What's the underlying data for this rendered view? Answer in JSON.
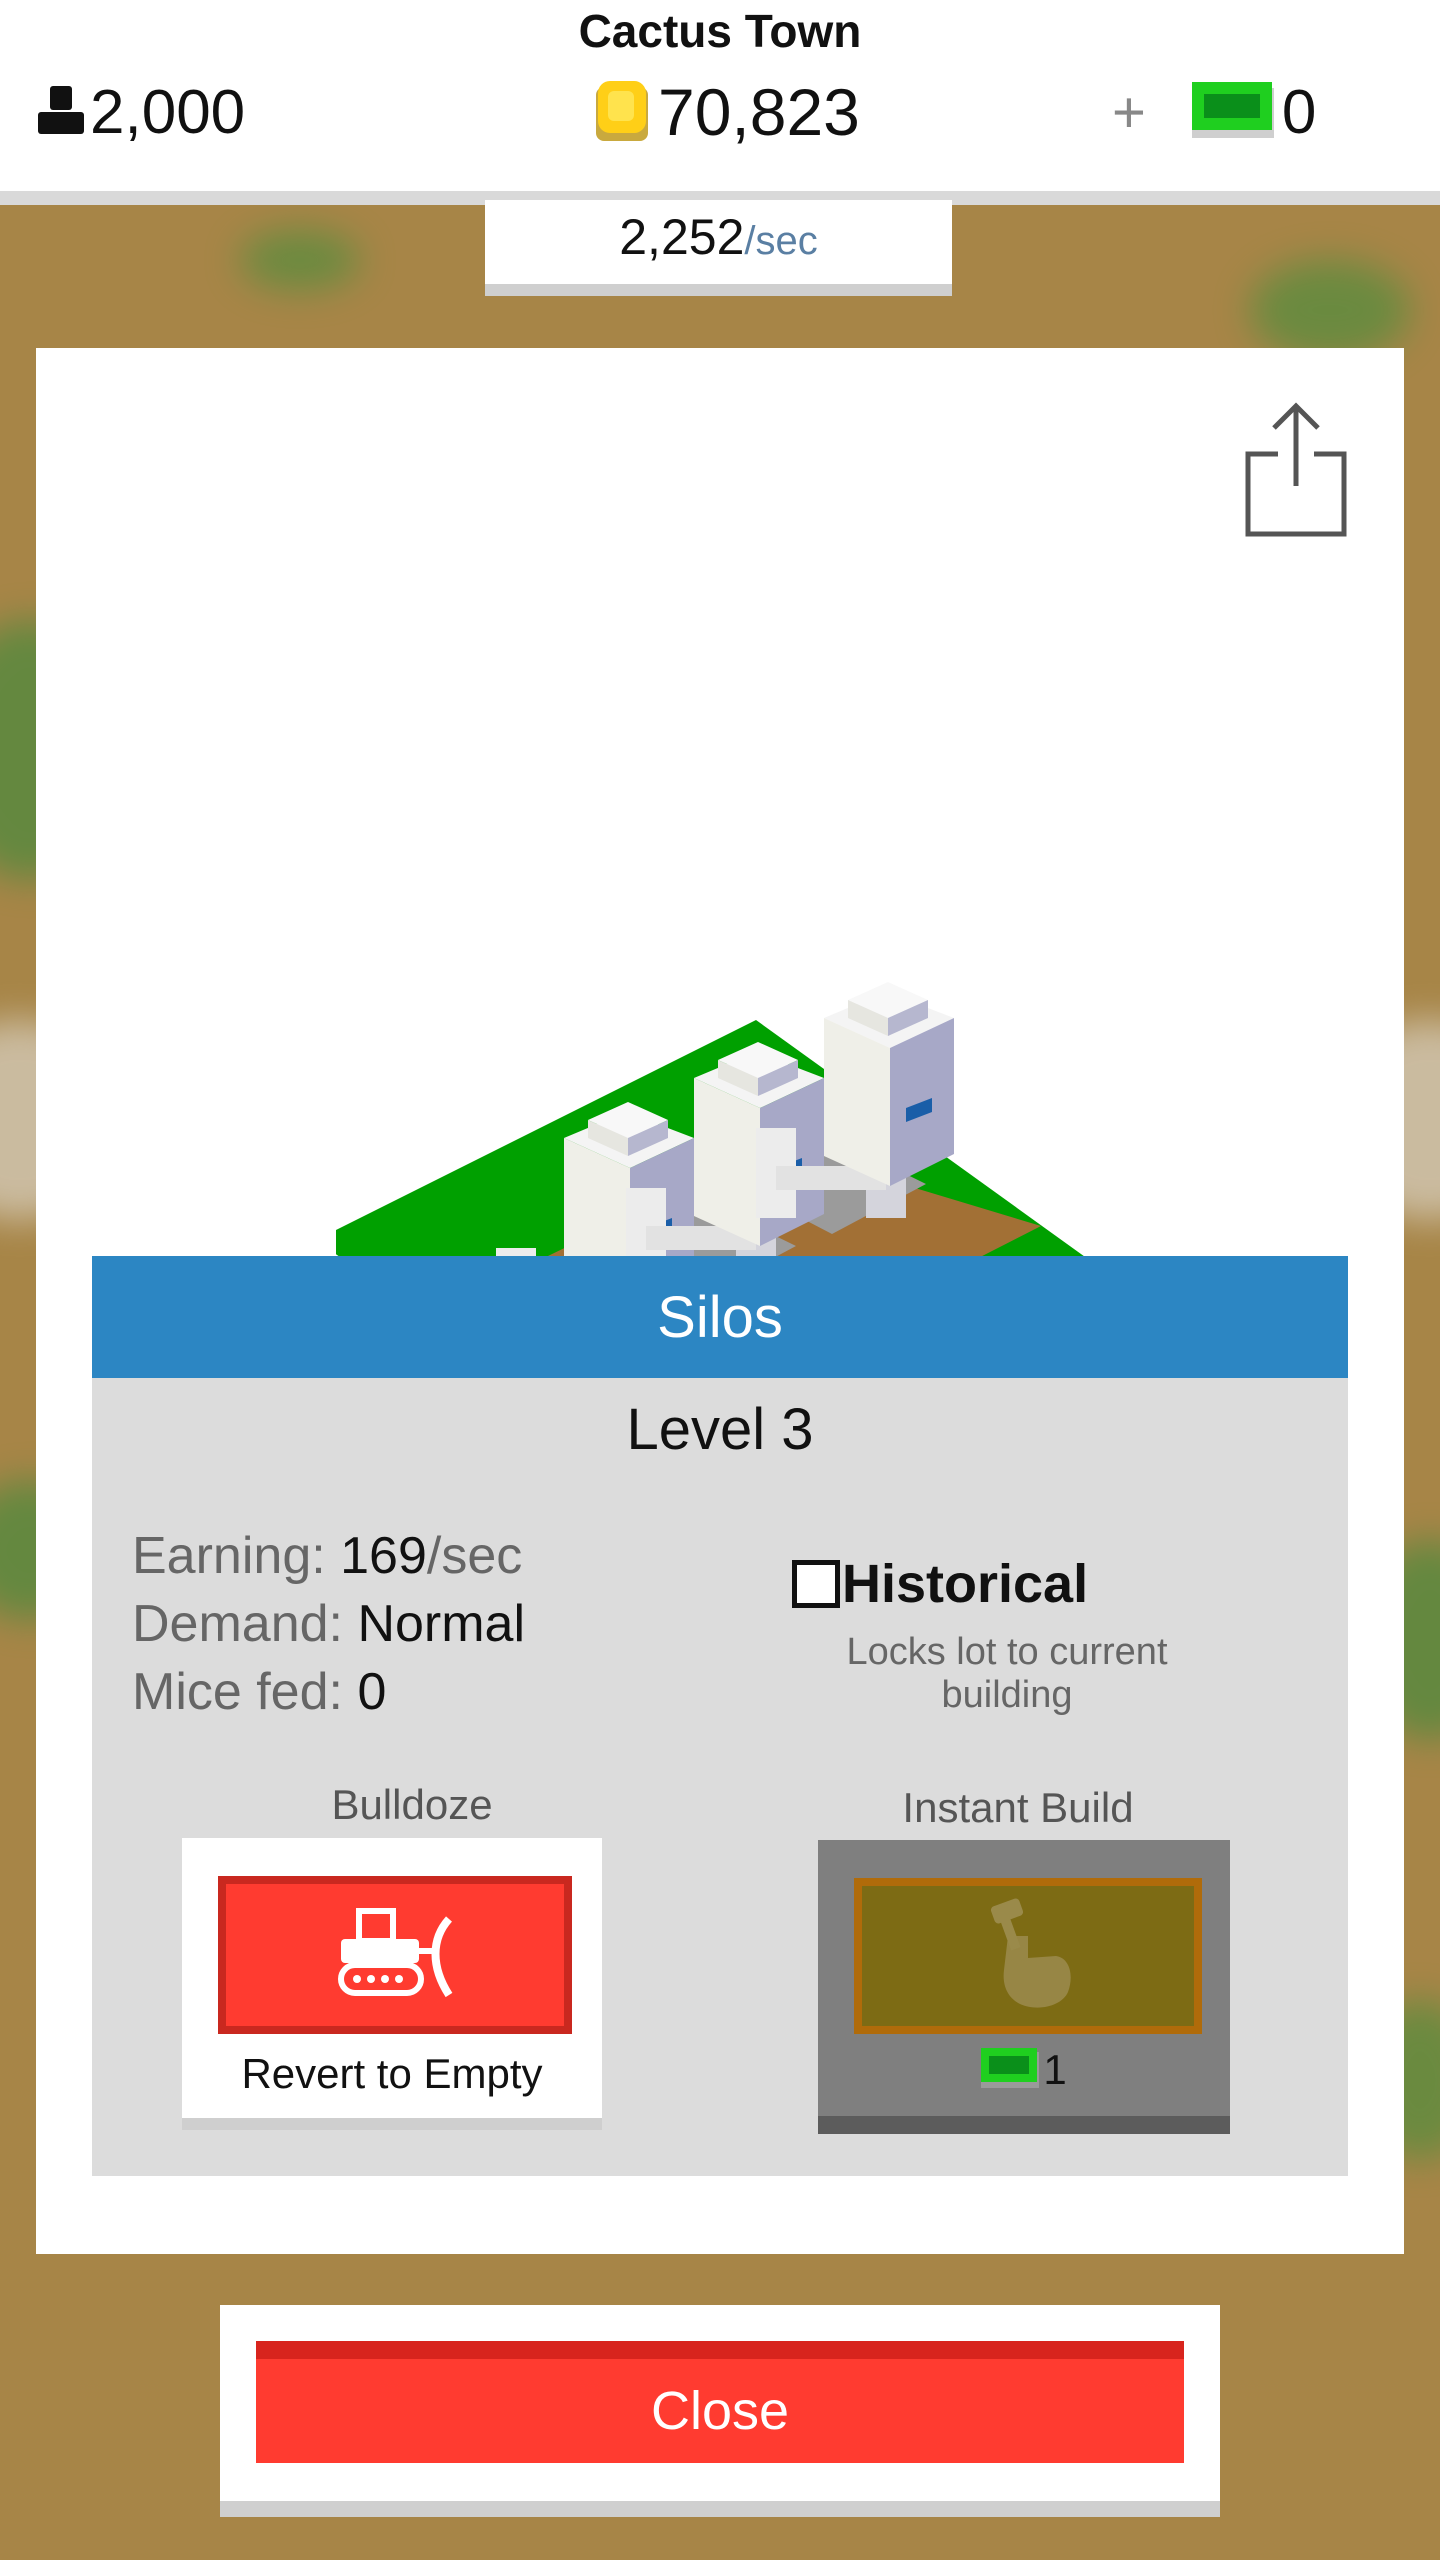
{
  "header": {
    "town_name": "Cactus Town",
    "population": "2,000",
    "coins": "70,823",
    "cash_plus": "+",
    "cash": "0",
    "income_rate": "2,252",
    "income_unit": "/sec"
  },
  "icons": {
    "population": "person-icon",
    "coins": "gold-coin-icon",
    "cash": "green-cash-icon",
    "share": "share-icon",
    "bulldoze": "bulldozer-icon",
    "instant_build": "hand-hammer-icon"
  },
  "building": {
    "name": "Silos",
    "level": "Level 3",
    "earning_label": "Earning:",
    "earning_value": "169",
    "earning_unit": "/sec",
    "demand_label": "Demand:",
    "demand_value": "Normal",
    "mice_label": "Mice fed:",
    "mice_value": "0"
  },
  "historical": {
    "label": "Historical",
    "hint": "Locks lot to current building",
    "checked": false
  },
  "bulldoze": {
    "caption": "Bulldoze",
    "label": "Revert to Empty"
  },
  "instant_build": {
    "caption": "Instant Build",
    "cost": "1"
  },
  "close": {
    "label": "Close"
  },
  "colors": {
    "title_bar": "#2c86c3",
    "red_button": "#ff3b30",
    "grass": "#00a000",
    "dirt": "#a27035",
    "panel": "#dcdcdc",
    "background": "#a58447"
  }
}
